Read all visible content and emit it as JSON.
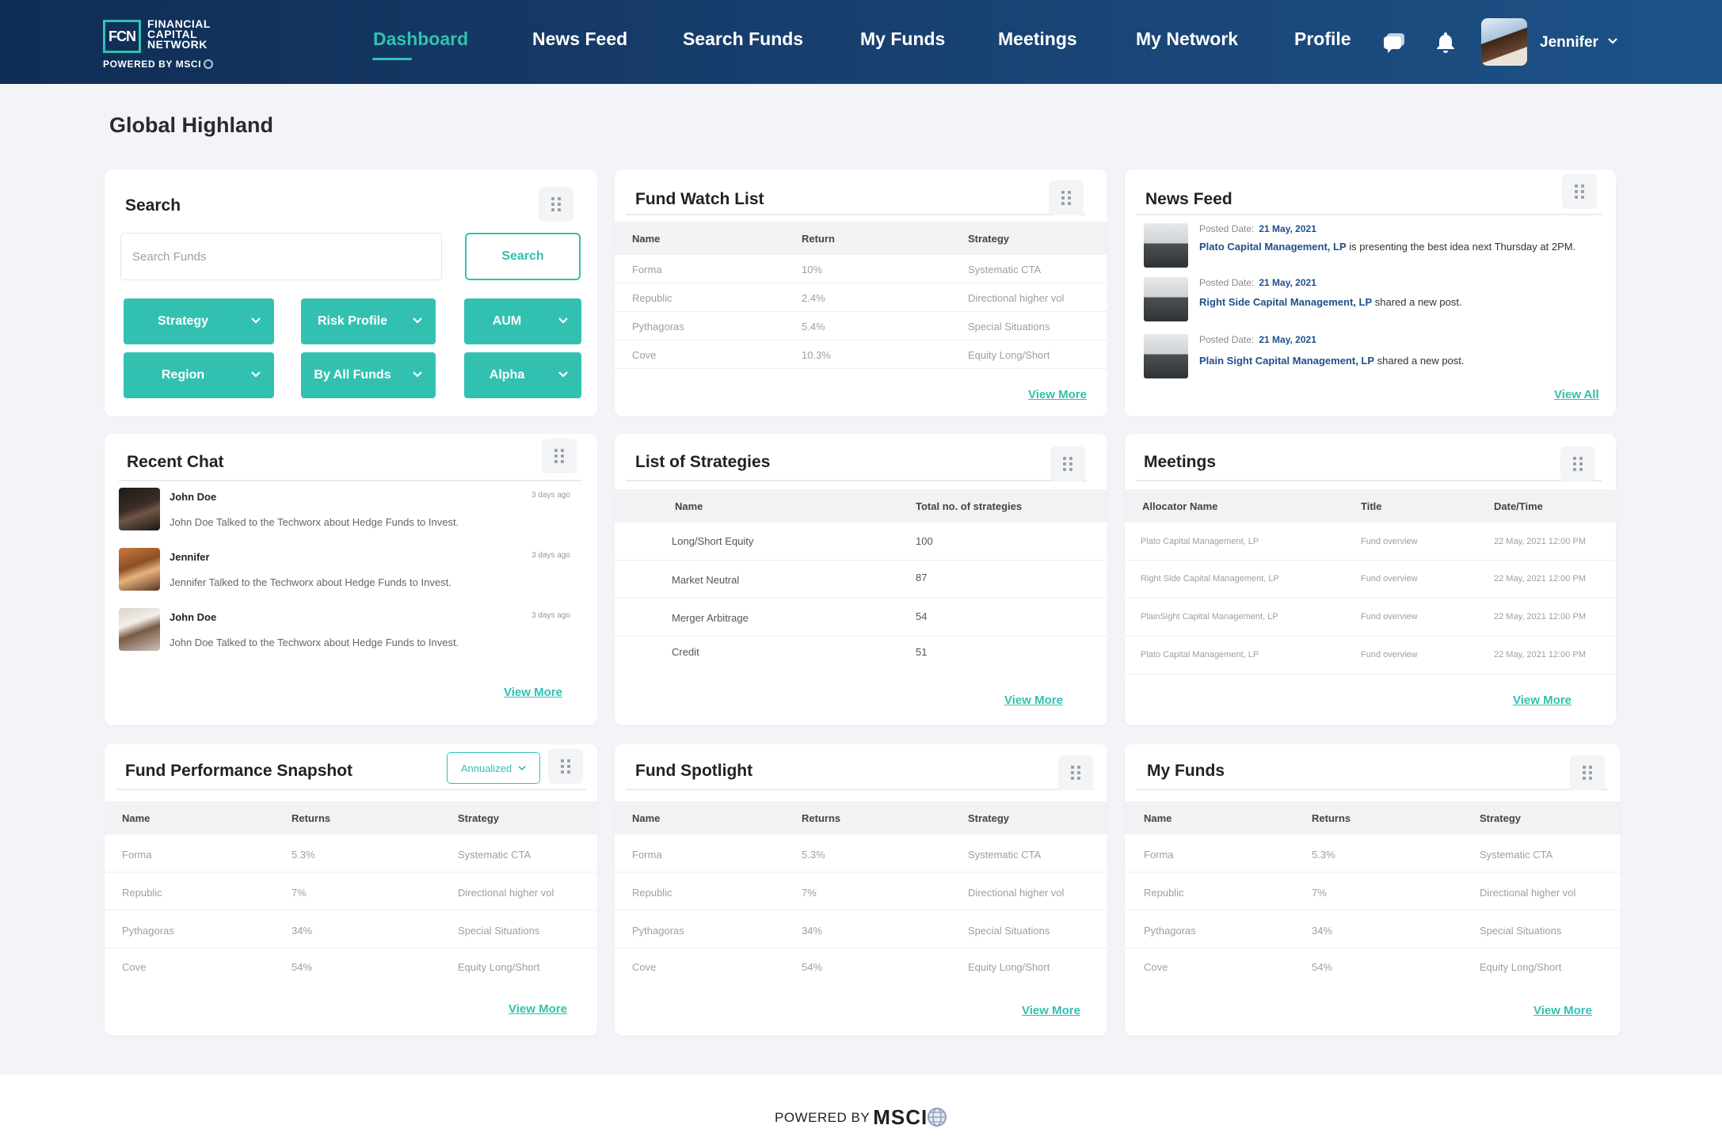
{
  "brand": {
    "logo_mark": "FCN",
    "name_line1": "FINANCIAL",
    "name_line2": "CAPITAL",
    "name_line3": "NETWORK",
    "powered": "POWERED BY MSCI",
    "accent_color": "#32c1b1",
    "nav_color": "#173e6d"
  },
  "nav": {
    "items": [
      "Dashboard",
      "News Feed",
      "Search Funds",
      "My Funds",
      "Meetings",
      "My Network",
      "Profile"
    ],
    "active": "Dashboard",
    "icons": [
      "chat-icon",
      "bell-icon"
    ],
    "user_name": "Jennifer"
  },
  "page": {
    "title": "Global Highland"
  },
  "search": {
    "title": "Search",
    "placeholder": "Search Funds",
    "button": "Search",
    "filters": [
      "Strategy",
      "Risk Profile",
      "AUM",
      "Region",
      "By All Funds",
      "Alpha"
    ]
  },
  "watch": {
    "title": "Fund Watch List",
    "columns": [
      "Name",
      "Return",
      "Strategy"
    ],
    "rows": [
      [
        "Forma",
        "10%",
        "Systematic CTA"
      ],
      [
        "Republic",
        "2.4%",
        "Directional higher vol"
      ],
      [
        "Pythagoras",
        "5.4%",
        "Special Situations"
      ],
      [
        "Cove",
        "10.3%",
        "Equity Long/Short"
      ]
    ],
    "more": "View More"
  },
  "news": {
    "title": "News Feed",
    "posted_label": "Posted Date:",
    "items": [
      {
        "date": "21 May, 2021",
        "company": "Plato Capital Management, LP",
        "text": " is presenting the best idea next Thursday at 2PM."
      },
      {
        "date": "21 May, 2021",
        "company": "Right Side Capital Management, LP",
        "text": " shared a new post."
      },
      {
        "date": "21 May, 2021",
        "company": "Plain Sight Capital Management, LP",
        "text": " shared a new post."
      }
    ],
    "more": "View All"
  },
  "chat": {
    "title": "Recent Chat",
    "items": [
      {
        "name": "John Doe",
        "ago": "3 days ago",
        "msg": "John Doe Talked to the Techworx about Hedge Funds to Invest."
      },
      {
        "name": "Jennifer",
        "ago": "3 days ago",
        "msg": "Jennifer   Talked to the Techworx about Hedge Funds to Invest."
      },
      {
        "name": "John Doe",
        "ago": "3 days ago",
        "msg": "John Doe Talked to the Techworx about Hedge Funds to Invest."
      }
    ],
    "more": "View More"
  },
  "strategies": {
    "title": "List of Strategies",
    "columns": [
      "Name",
      "Total no. of strategies"
    ],
    "rows": [
      [
        "Long/Short Equity",
        "100"
      ],
      [
        "Market Neutral",
        "87"
      ],
      [
        "Merger Arbitrage",
        "54"
      ],
      [
        "Credit",
        "51"
      ]
    ],
    "more": "View More"
  },
  "meetings": {
    "title": "Meetings",
    "columns": [
      "Allocator Name",
      "Title",
      "Date/Time"
    ],
    "rows": [
      [
        "Plato Capital Management, LP",
        "Fund overview",
        "22 May, 2021 12:00 PM"
      ],
      [
        "Right Side Capital Management, LP",
        "Fund overview",
        "22 May, 2021 12:00 PM"
      ],
      [
        "PlainSight Capital Management, LP",
        "Fund overview",
        "22 May, 2021 12:00 PM"
      ],
      [
        "Plato Capital Management, LP",
        "Fund overview",
        "22 May, 2021 12:00 PM"
      ]
    ],
    "more": "View More"
  },
  "performance": {
    "title": "Fund Performance Snapshot",
    "period": "Annualized",
    "columns": [
      "Name",
      "Returns",
      "Strategy"
    ],
    "rows": [
      [
        "Forma",
        "5.3%",
        "Systematic CTA"
      ],
      [
        "Republic",
        "7%",
        "Directional higher vol"
      ],
      [
        "Pythagoras",
        "34%",
        "Special Situations"
      ],
      [
        "Cove",
        "54%",
        "Equity Long/Short"
      ]
    ],
    "more": "View More"
  },
  "spotlight": {
    "title": "Fund Spotlight",
    "columns": [
      "Name",
      "Returns",
      "Strategy"
    ],
    "rows": [
      [
        "Forma",
        "5.3%",
        "Systematic CTA"
      ],
      [
        "Republic",
        "7%",
        "Directional higher vol"
      ],
      [
        "Pythagoras",
        "34%",
        "Special Situations"
      ],
      [
        "Cove",
        "54%",
        "Equity Long/Short"
      ]
    ],
    "more": "View More"
  },
  "myfunds": {
    "title": "My Funds",
    "columns": [
      "Name",
      "Returns",
      "Strategy"
    ],
    "rows": [
      [
        "Forma",
        "5.3%",
        "Systematic CTA"
      ],
      [
        "Republic",
        "7%",
        "Directional higher vol"
      ],
      [
        "Pythagoras",
        "34%",
        "Special Situations"
      ],
      [
        "Cove",
        "54%",
        "Equity Long/Short"
      ]
    ],
    "more": "View More"
  },
  "footer": {
    "powered": "POWERED BY",
    "msci": "MSCI"
  }
}
